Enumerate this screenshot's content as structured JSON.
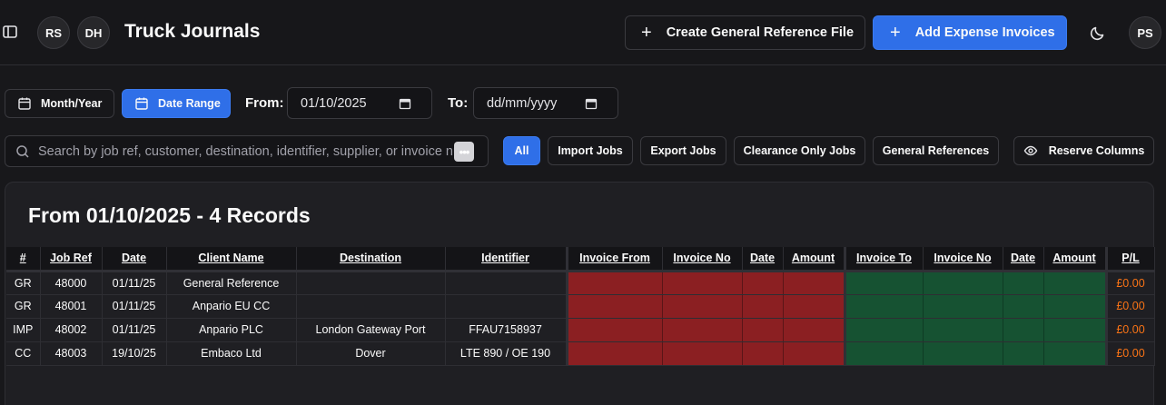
{
  "header": {
    "avatars": [
      "RS",
      "DH"
    ],
    "title": "Truck Journals",
    "create_button": "Create General Reference File",
    "add_button": "Add Expense Invoices",
    "user_avatar": "PS",
    "icons": {
      "sidebar": "sidebar-toggle-icon",
      "theme": "moon-icon"
    }
  },
  "filters": {
    "month_year": "Month/Year",
    "date_range": "Date Range",
    "from_label": "From:",
    "from_value": "01/10/2025",
    "to_label": "To:",
    "to_value": "dd/mm/yyyy"
  },
  "search": {
    "placeholder": "Search by job ref, customer, destination, identifier, supplier, or invoice nu"
  },
  "chips": [
    "All",
    "Import Jobs",
    "Export Jobs",
    "Clearance Only Jobs",
    "General References"
  ],
  "reserve_columns": "Reserve Columns",
  "card": {
    "title": "From 01/10/2025 - 4 Records"
  },
  "table": {
    "headers": [
      "#",
      "Job Ref",
      "Date",
      "Client Name",
      "Destination",
      "Identifier",
      "Invoice From",
      "Invoice No",
      "Date",
      "Amount",
      "Invoice To",
      "Invoice No",
      "Date",
      "Amount",
      "P/L"
    ],
    "rows": [
      [
        "GR",
        "48000",
        "01/11/25",
        "General Reference",
        "",
        "",
        "",
        "",
        "",
        "",
        "",
        "",
        "",
        "",
        "£0.00"
      ],
      [
        "GR",
        "48001",
        "01/11/25",
        "Anpario EU CC",
        "",
        "",
        "",
        "",
        "",
        "",
        "",
        "",
        "",
        "",
        "£0.00"
      ],
      [
        "IMP",
        "48002",
        "01/11/25",
        "Anpario PLC",
        "London Gateway Port",
        "FFAU7158937",
        "",
        "",
        "",
        "",
        "",
        "",
        "",
        "",
        "£0.00"
      ],
      [
        "CC",
        "48003",
        "19/10/25",
        "Embaco Ltd",
        "Dover",
        "LTE 890 / OE 190",
        "",
        "",
        "",
        "",
        "",
        "",
        "",
        "",
        "£0.00"
      ]
    ]
  },
  "colors": {
    "accent": "#2f6fe8",
    "expense_cell": "#8b1f22",
    "income_cell": "#165232",
    "pl_text": "#f97316"
  }
}
